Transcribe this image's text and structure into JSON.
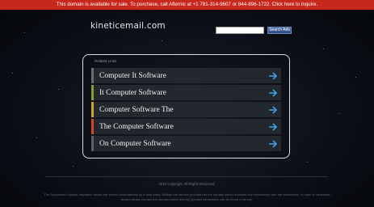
{
  "banner": {
    "text": "This domain is available for sale. To purchase, call Afternic at +1 781-314-9607 or 844-896-1722. Click here to inquire."
  },
  "header": {
    "logo": "kineticemail.com",
    "search_placeholder": "",
    "search_button_label": "Search Ads"
  },
  "related": {
    "title": "Related Links",
    "items": [
      {
        "label": "Computer It Software",
        "accent": "#6d6d6d"
      },
      {
        "label": "It Computer Software",
        "accent": "#8f9a2f"
      },
      {
        "label": "Computer Software The",
        "accent": "#c9a52c"
      },
      {
        "label": "The Computer Software",
        "accent": "#d24a1c"
      },
      {
        "label": "On Computer Software",
        "accent": "#5b5f66"
      }
    ],
    "arrow_color": "#3fa0e6"
  },
  "footer": {
    "copyright": "2018 Copyright. All Rights Reserved.",
    "disclaimer": "The Sponsored Listings displayed above are served automatically by a third party. Neither the service provider nor the domain owner maintain any relationship with the advertisers. In case of trademark issues please contact the domain owner directly (contact information can be found in whois)."
  }
}
